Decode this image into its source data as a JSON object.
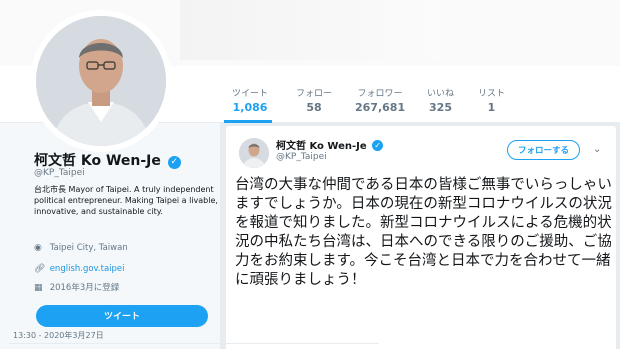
{
  "profile": {
    "name": "柯文哲 Ko Wen-Je",
    "handle": "@KP_Taipei",
    "bio": "台北市長 Mayor of Taipei. A truly independent political entrepreneur. Making Taipei a livable, innovative, and sustainable city.",
    "location": "Taipei City, Taiwan",
    "website": "english.gov.taipei",
    "joined": "2016年3月に登録",
    "tweet_button": "ツイート"
  },
  "stats": [
    {
      "label": "ツイート",
      "value": "1,086"
    },
    {
      "label": "フォロー",
      "value": "58"
    },
    {
      "label": "フォロワー",
      "value": "267,681"
    },
    {
      "label": "いいね",
      "value": "325"
    },
    {
      "label": "リスト",
      "value": "1"
    }
  ],
  "tweet": {
    "name": "柯文哲 Ko Wen-Je",
    "handle": "@KP_Taipei",
    "follow_label": "フォローする",
    "text": "台湾の大事な仲間である日本の皆様ご無事でいらっしゃいますでしょうか。日本の現在の新型コロナウイルスの状況を報道で知りました。新型コロナウイルスによる危機的状況の中私たち台湾は、日本へのできる限りのご援助、ご協力をお約束します。今こそ台湾と日本で力を合わせて一緒に頑張りましょう！",
    "timestamp": "13:30 - 2020年3月27日"
  },
  "icons": {
    "verified": "verified-badge-icon",
    "location": "location-pin-icon",
    "link": "link-icon",
    "calendar": "calendar-icon",
    "chevron": "chevron-down-icon"
  },
  "colors": {
    "accent": "#1da1f2",
    "background": "#e6ecf0",
    "muted_text": "#657786"
  }
}
